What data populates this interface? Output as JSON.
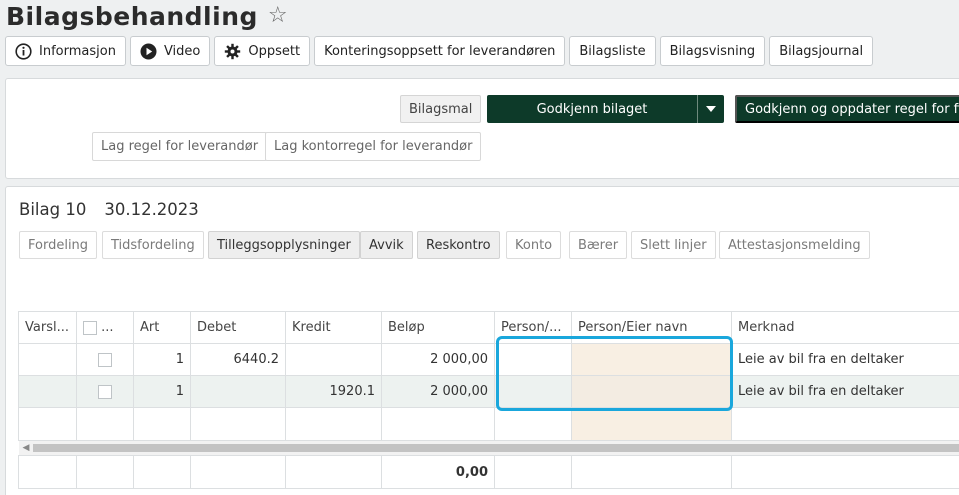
{
  "header": {
    "title": "Bilagsbehandling",
    "favorite_icon": "star-outline-icon"
  },
  "toolbar": [
    {
      "label": "Informasjon",
      "icon": "info-circle-icon"
    },
    {
      "label": "Video",
      "icon": "play-circle-icon"
    },
    {
      "label": "Oppsett",
      "icon": "gear-icon"
    },
    {
      "label": "Konteringsoppsett for leverandøren"
    },
    {
      "label": "Bilagsliste"
    },
    {
      "label": "Bilagsvisning"
    },
    {
      "label": "Bilagsjournal"
    }
  ],
  "actions": {
    "bilagsmal": "Bilagsmal",
    "approve": "Godkjenn bilaget",
    "approve_update": "Godkjenn og oppdater regel for firm",
    "supplier_rule": "Lag regel for leverandør",
    "account_rule": "Lag kontorregel for leverandør"
  },
  "voucher": {
    "number_label": "Bilag 10",
    "date": "30.12.2023"
  },
  "tabs": [
    {
      "label": "Fordeling",
      "style": "outline"
    },
    {
      "label": "Tidsfordeling",
      "style": "outline"
    },
    {
      "label": "Tilleggsopplysninger",
      "style": "grey"
    },
    {
      "label": "Avvik",
      "style": "grey"
    },
    {
      "label": "Reskontro",
      "style": "grey"
    },
    {
      "label": "Konto",
      "style": "outline"
    },
    {
      "label": "Bærer",
      "style": "outline"
    },
    {
      "label": "Slett linjer",
      "style": "outline"
    },
    {
      "label": "Attestasjonsmelding",
      "style": "outline"
    }
  ],
  "grid": {
    "columns": {
      "varsel": "Varsl...",
      "select": "...",
      "art": "Art",
      "debet": "Debet",
      "kredit": "Kredit",
      "belop": "Beløp",
      "person": "Person/...",
      "person_name": "Person/Eier navn",
      "merknad": "Merknad"
    },
    "rows": [
      {
        "art": "1",
        "debet": "6440.2",
        "kredit": "",
        "belop": "2 000,00",
        "person": "",
        "person_name": "",
        "merknad": "Leie av bil fra en deltaker"
      },
      {
        "art": "1",
        "debet": "",
        "kredit": "1920.1",
        "belop": "2 000,00",
        "person": "",
        "person_name": "",
        "merknad": "Leie av bil fra en deltaker"
      }
    ],
    "total": "0,00"
  },
  "colors": {
    "primary_dark": "#0d3a29",
    "highlight": "#1aa7dc",
    "peach": "#f8efe3"
  }
}
